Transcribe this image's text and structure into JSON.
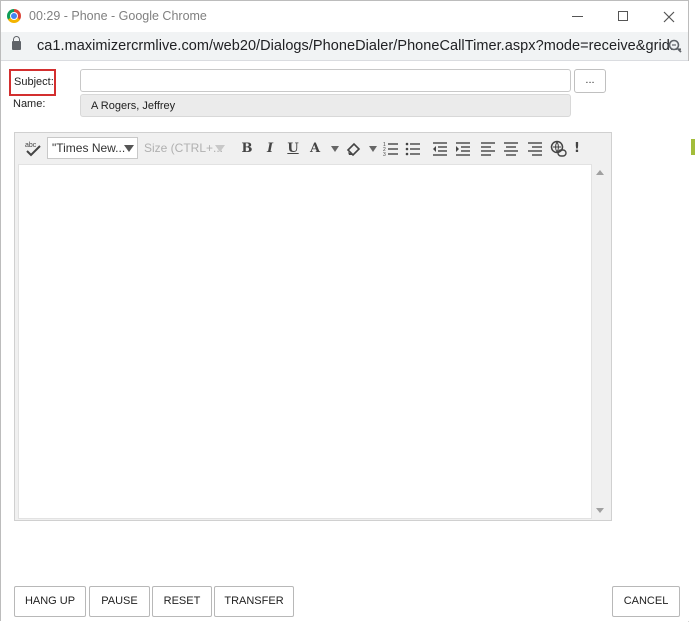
{
  "window": {
    "title": "00:29 - Phone - Google Chrome",
    "url": "ca1.maximizercrmlive.com/web20/Dialogs/PhoneDialer/PhoneCallTimer.aspx?mode=receive&grid..."
  },
  "form": {
    "subject_label": "Subject:",
    "subject_value": "",
    "browse_label": "...",
    "name_label": "Name:",
    "name_value": "A Rogers, Jeffrey"
  },
  "editor": {
    "font_value": "\"Times New...",
    "size_placeholder": "Size (CTRL+...",
    "icons": [
      "spellcheck-icon",
      "bold-icon",
      "italic-icon",
      "underline-icon",
      "font-color-icon",
      "highlight-icon",
      "numbered-list-icon",
      "bullet-list-icon",
      "outdent-icon",
      "indent-icon",
      "align-left-icon",
      "align-center-icon",
      "align-right-icon",
      "insert-link-icon",
      "important-icon"
    ]
  },
  "buttons": {
    "hang_up": "HANG UP",
    "pause": "PAUSE",
    "reset": "RESET",
    "transfer": "TRANSFER",
    "cancel": "CANCEL"
  },
  "colors": {
    "highlight_border": "#d32f2f"
  }
}
